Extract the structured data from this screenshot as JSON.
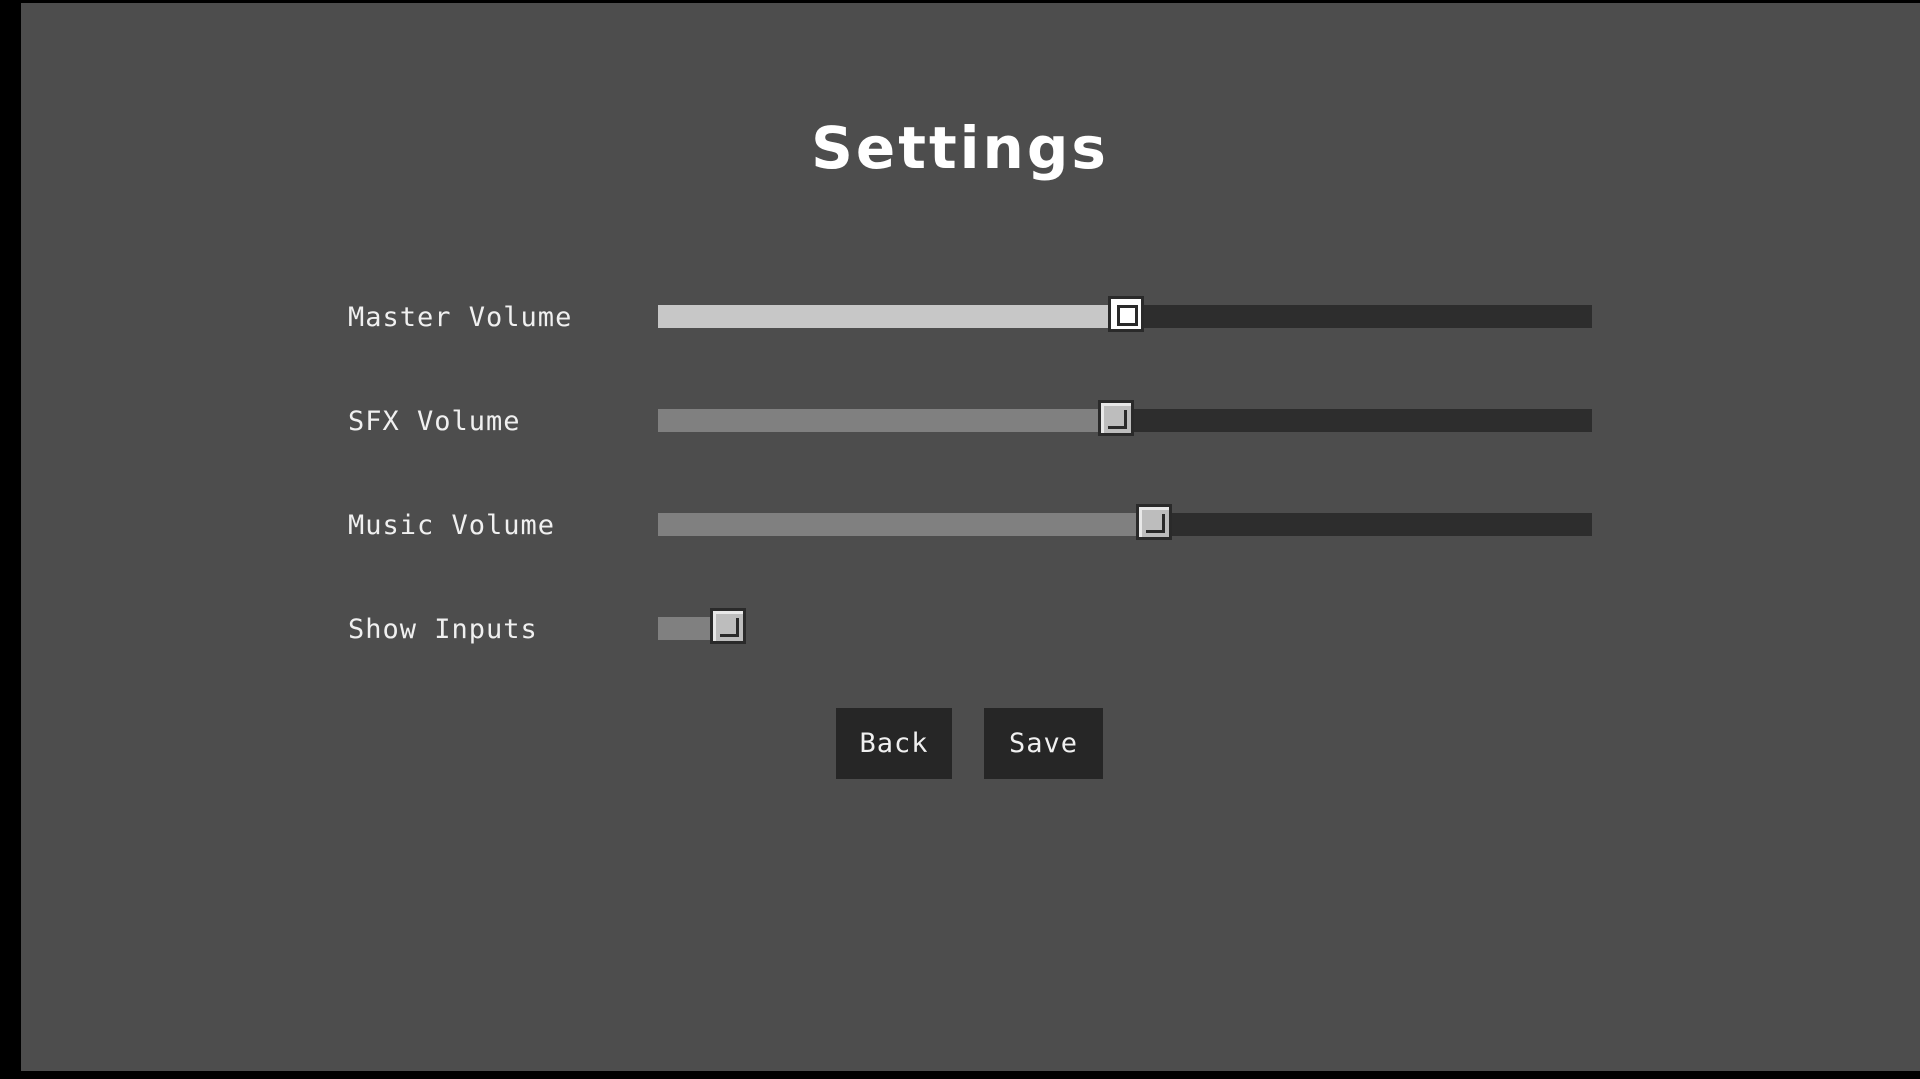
{
  "title": "Settings",
  "settings": [
    {
      "label": "Master Volume",
      "value": 0.49,
      "focused": true
    },
    {
      "label": "SFX Volume",
      "value": 0.48,
      "focused": false
    },
    {
      "label": "Music Volume",
      "value": 0.52,
      "focused": false
    }
  ],
  "toggle": {
    "label": "Show Inputs",
    "on": true
  },
  "buttons": {
    "back": "Back",
    "save": "Save"
  },
  "colors": {
    "background": "#4d4d4d",
    "frame": "#000000",
    "track": "#2d2d2d",
    "fill": "#808080",
    "fill_focused": "#c7c7c7",
    "button": "#262626",
    "text": "#ffffff"
  }
}
